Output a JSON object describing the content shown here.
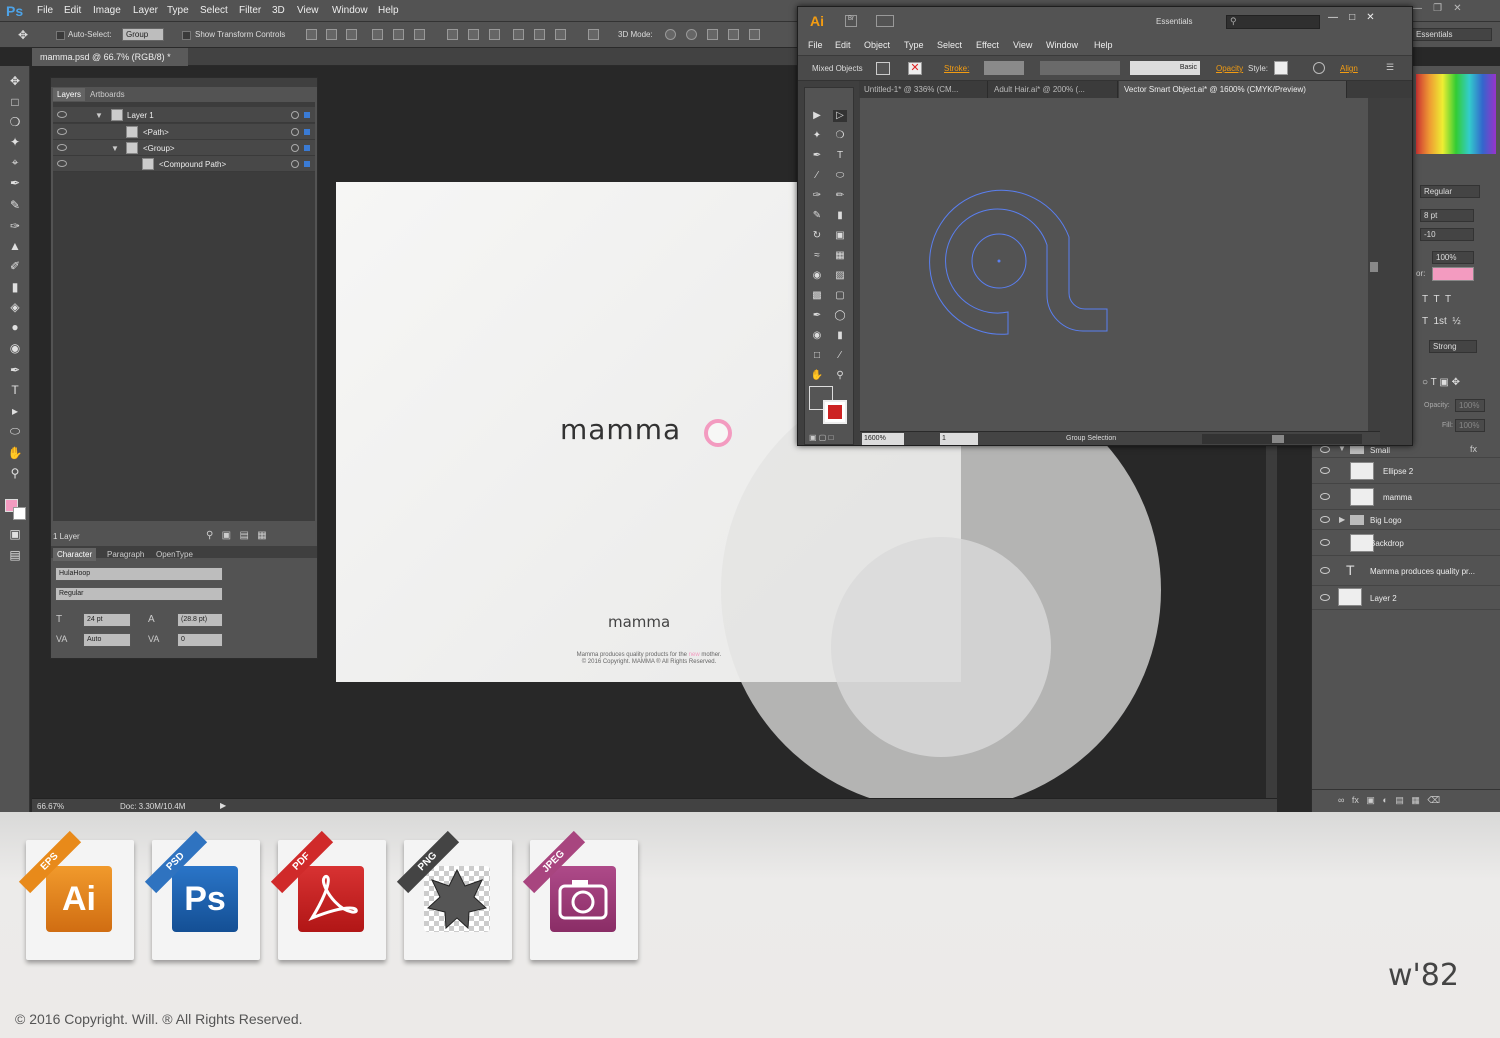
{
  "photoshop": {
    "logo": "Ps",
    "menu": [
      "File",
      "Edit",
      "Image",
      "Layer",
      "Type",
      "Select",
      "Filter",
      "3D",
      "View",
      "Window",
      "Help"
    ],
    "options": {
      "auto_select_label": "Auto-Select:",
      "auto_select_value": "Group",
      "show_transform_label": "Show Transform Controls",
      "mode_3d_label": "3D Mode:",
      "workspace": "Essentials"
    },
    "doc_tab": "mamma.psd @ 66.7% (RGB/8) *",
    "status_zoom": "66.67%",
    "status_doc": "Doc: 3.30M/10.4M",
    "layers_panel": {
      "tabs": [
        "Layers",
        "Artboards"
      ],
      "rows": [
        {
          "name": "Layer 1"
        },
        {
          "name": "<Path>"
        },
        {
          "name": "<Group>"
        },
        {
          "name": "<Compound Path>"
        }
      ],
      "footer": "1 Layer"
    },
    "character_panel": {
      "tabs": [
        "Character",
        "Paragraph",
        "OpenType"
      ],
      "font": "HulaHoop",
      "style": "Regular",
      "size": "24 pt",
      "leading": "(28.8 pt)",
      "kerning": "Auto",
      "tracking": "0"
    },
    "right_panel": {
      "char_style": "Regular",
      "size": "8 pt",
      "tracking": "-10",
      "scale": "100%",
      "color_label": "or:",
      "anti_alias": "Strong",
      "opacity_label": "Opacity:",
      "opacity_value": "100%",
      "fill_label": "Fill:",
      "fill_value": "100%",
      "layers": [
        {
          "name": "Small"
        },
        {
          "name": "Ellipse 2"
        },
        {
          "name": "mamma"
        },
        {
          "name": "Big Logo"
        },
        {
          "name": "Backdrop"
        },
        {
          "name": "Mamma produces quality pr..."
        },
        {
          "name": "Layer 2"
        }
      ]
    },
    "document": {
      "logo_text": "mamma",
      "small_logo": "mamma",
      "tagline_pre": "Mamma produces quality products for the ",
      "tagline_highlight": "new",
      "tagline_post": " mother.",
      "copyright": "© 2016 Copyright. MAMMA ® All Rights Reserved."
    }
  },
  "illustrator": {
    "logo": "Ai",
    "br": "Br",
    "workspace": "Essentials",
    "menu": [
      "File",
      "Edit",
      "Object",
      "Type",
      "Select",
      "Effect",
      "View",
      "Window",
      "Help"
    ],
    "control": {
      "selection": "Mixed Objects",
      "stroke_label": "Stroke:",
      "brush": "Basic",
      "opacity_label": "Opacity",
      "style_label": "Style:",
      "align_label": "Align"
    },
    "tabs": [
      "Untitled-1* @ 336% (CM...",
      "Adult Hair.ai* @ 200% (...",
      "Vector Smart Object.ai* @ 1600% (CMYK/Preview)"
    ],
    "zoom": "1600%",
    "artboard": "1",
    "status": "Group Selection"
  },
  "formats": [
    {
      "ribbon": "EPS",
      "label": "Ai",
      "color": "#e07a18",
      "ribbon_color": "#e88a1a"
    },
    {
      "ribbon": "PSD",
      "label": "Ps",
      "color": "#1c5fa8",
      "ribbon_color": "#2f73c0"
    },
    {
      "ribbon": "PDF",
      "label": "pdf",
      "color": "#c41c1c",
      "ribbon_color": "#d02a2a"
    },
    {
      "ribbon": "PNG",
      "label": "png",
      "color": "#555555",
      "ribbon_color": "#444444"
    },
    {
      "ribbon": "JPEG",
      "label": "camera",
      "color": "#9c3a7a",
      "ribbon_color": "#a8457f"
    }
  ],
  "footer": {
    "copyright": "© 2016 Copyright. Will. ® All Rights Reserved.",
    "signature": "w'82"
  }
}
